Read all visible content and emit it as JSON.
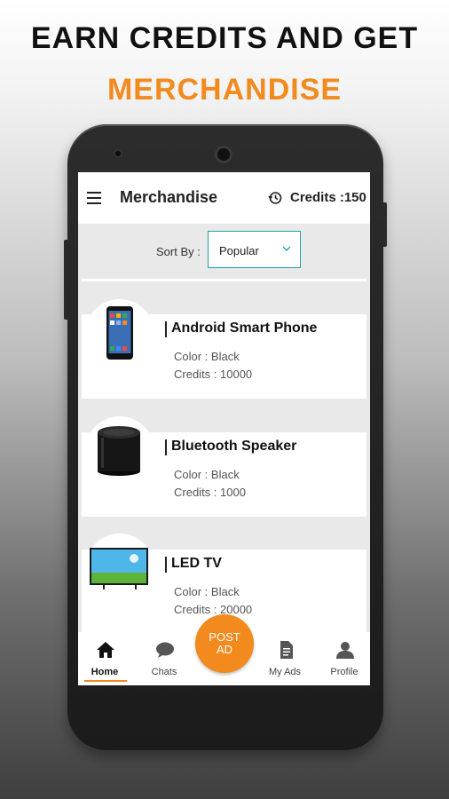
{
  "promo": {
    "line1": "EARN CREDITS AND GET",
    "line2": "MERCHANDISE"
  },
  "appbar": {
    "title": "Merchandise",
    "credits": "Credits :150",
    "menu_icon": "hamburger-menu-icon",
    "history_icon": "history-icon"
  },
  "sort": {
    "label": "Sort By :",
    "selected": "Popular"
  },
  "items": [
    {
      "name": "Android Smart Phone",
      "color": "Color : Black",
      "credits": "Credits : 10000",
      "image": "smartphone-image"
    },
    {
      "name": "Bluetooth Speaker",
      "color": "Color : Black",
      "credits": "Credits : 1000",
      "image": "speaker-image"
    },
    {
      "name": "LED TV",
      "color": "Color : Black",
      "credits": "Credits : 20000",
      "image": "tv-image"
    }
  ],
  "nav": {
    "home": "Home",
    "chats": "Chats",
    "post_line1": "POST",
    "post_line2": "AD",
    "my_ads": "My Ads",
    "profile": "Profile"
  },
  "colors": {
    "accent": "#f28a1e",
    "select_border": "#1fa3a8"
  }
}
